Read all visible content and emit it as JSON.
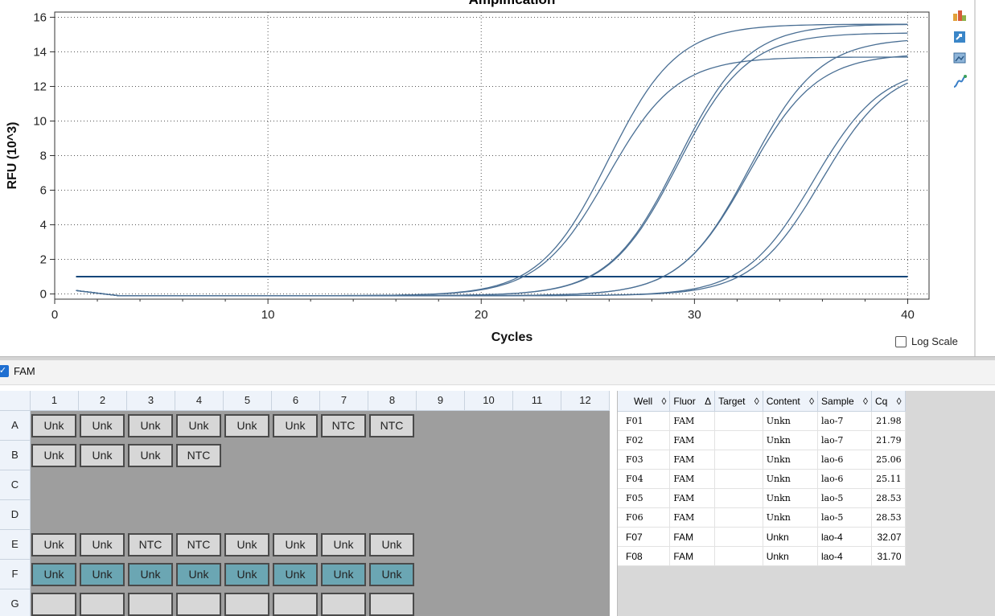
{
  "chart_data": {
    "type": "line",
    "title": "Amplification",
    "xlabel": "Cycles",
    "ylabel": "RFU (10^3)",
    "xlim": [
      0,
      41
    ],
    "ylim": [
      -0.3,
      16.3
    ],
    "xticks": [
      0,
      10,
      20,
      30,
      40
    ],
    "yticks": [
      0,
      2,
      4,
      6,
      8,
      10,
      12,
      14,
      16
    ],
    "grid": true,
    "threshold": 1.0,
    "series": [
      {
        "well": "F01",
        "cq": 21.98,
        "plateau": 13.7
      },
      {
        "well": "F02",
        "cq": 21.79,
        "plateau": 15.6
      },
      {
        "well": "F03",
        "cq": 25.06,
        "plateau": 15.6
      },
      {
        "well": "F04",
        "cq": 25.11,
        "plateau": 15.1
      },
      {
        "well": "F05",
        "cq": 28.53,
        "plateau": 14.8
      },
      {
        "well": "F06",
        "cq": 28.53,
        "plateau": 13.9
      },
      {
        "well": "F07",
        "cq": 32.07,
        "plateau": 13.2
      },
      {
        "well": "F08",
        "cq": 31.7,
        "plateau": 13.2
      }
    ]
  },
  "colors": {
    "curve": "#4a6f94",
    "threshold": "#15467a",
    "well_selected": "#6ba6b3",
    "well_default": "#d7d7d7"
  },
  "log_scale_label": "Log Scale",
  "fluor_checkbox_label": "FAM",
  "toolbar_icons": [
    "chart-settings-icon",
    "export-icon",
    "image-icon",
    "curve-analysis-icon"
  ],
  "plate": {
    "columns": [
      "1",
      "2",
      "3",
      "4",
      "5",
      "6",
      "7",
      "8",
      "9",
      "10",
      "11",
      "12"
    ],
    "rows": [
      {
        "label": "A",
        "wells": [
          "Unk",
          "Unk",
          "Unk",
          "Unk",
          "Unk",
          "Unk",
          "NTC",
          "NTC"
        ]
      },
      {
        "label": "B",
        "wells": [
          "Unk",
          "Unk",
          "Unk",
          "NTC"
        ]
      },
      {
        "label": "C",
        "wells": []
      },
      {
        "label": "D",
        "wells": []
      },
      {
        "label": "E",
        "wells": [
          "Unk",
          "Unk",
          "NTC",
          "NTC",
          "Unk",
          "Unk",
          "Unk",
          "Unk"
        ]
      },
      {
        "label": "F",
        "wells": [
          "Unk",
          "Unk",
          "Unk",
          "Unk",
          "Unk",
          "Unk",
          "Unk",
          "Unk"
        ],
        "selected": true
      },
      {
        "label": "G",
        "wells": [
          "",
          "",
          "",
          "",
          "",
          "",
          "",
          ""
        ]
      }
    ]
  },
  "table": {
    "headers": [
      "Well",
      "Fluor",
      "Target",
      "Content",
      "Sample",
      "Cq"
    ],
    "sort_icons": [
      "◊",
      "Δ",
      "◊",
      "◊",
      "◊",
      "◊"
    ],
    "rows": [
      [
        "F01",
        "FAM",
        "",
        "Unkn",
        "lao-7",
        "21.98"
      ],
      [
        "F02",
        "FAM",
        "",
        "Unkn",
        "lao-7",
        "21.79"
      ],
      [
        "F03",
        "FAM",
        "",
        "Unkn",
        "lao-6",
        "25.06"
      ],
      [
        "F04",
        "FAM",
        "",
        "Unkn",
        "lao-6",
        "25.11"
      ],
      [
        "F05",
        "FAM",
        "",
        "Unkn",
        "lao-5",
        "28.53"
      ],
      [
        "F06",
        "FAM",
        "",
        "Unkn",
        "lao-5",
        "28.53"
      ],
      [
        "F07",
        "FAM",
        "",
        "Unkn",
        "lao-4",
        "32.07"
      ],
      [
        "F08",
        "FAM",
        "",
        "Unkn",
        "lao-4",
        "31.70"
      ]
    ]
  }
}
